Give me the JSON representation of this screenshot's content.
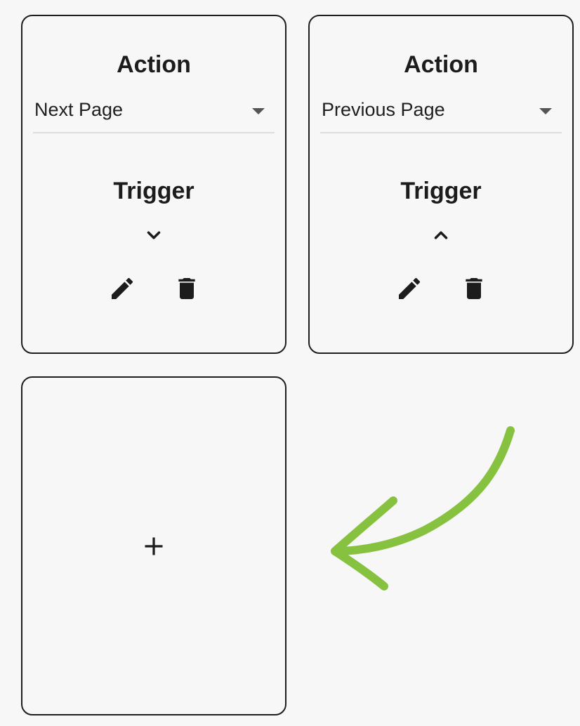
{
  "cards": [
    {
      "action_heading": "Action",
      "action_value": "Next Page",
      "trigger_heading": "Trigger",
      "trigger_icon": "chevron-down-icon",
      "edit_icon": "pencil-icon",
      "delete_icon": "trash-icon"
    },
    {
      "action_heading": "Action",
      "action_value": "Previous Page",
      "trigger_heading": "Trigger",
      "trigger_icon": "chevron-up-icon",
      "edit_icon": "pencil-icon",
      "delete_icon": "trash-icon"
    }
  ],
  "add_card": {
    "icon": "plus-icon",
    "label": "+"
  },
  "annotation": {
    "icon": "curved-arrow-icon",
    "color": "#86c240"
  },
  "colors": {
    "background": "#f7f7f7",
    "border": "#1e1e1e",
    "text": "#1c1c1c",
    "divider": "#dddddd"
  }
}
